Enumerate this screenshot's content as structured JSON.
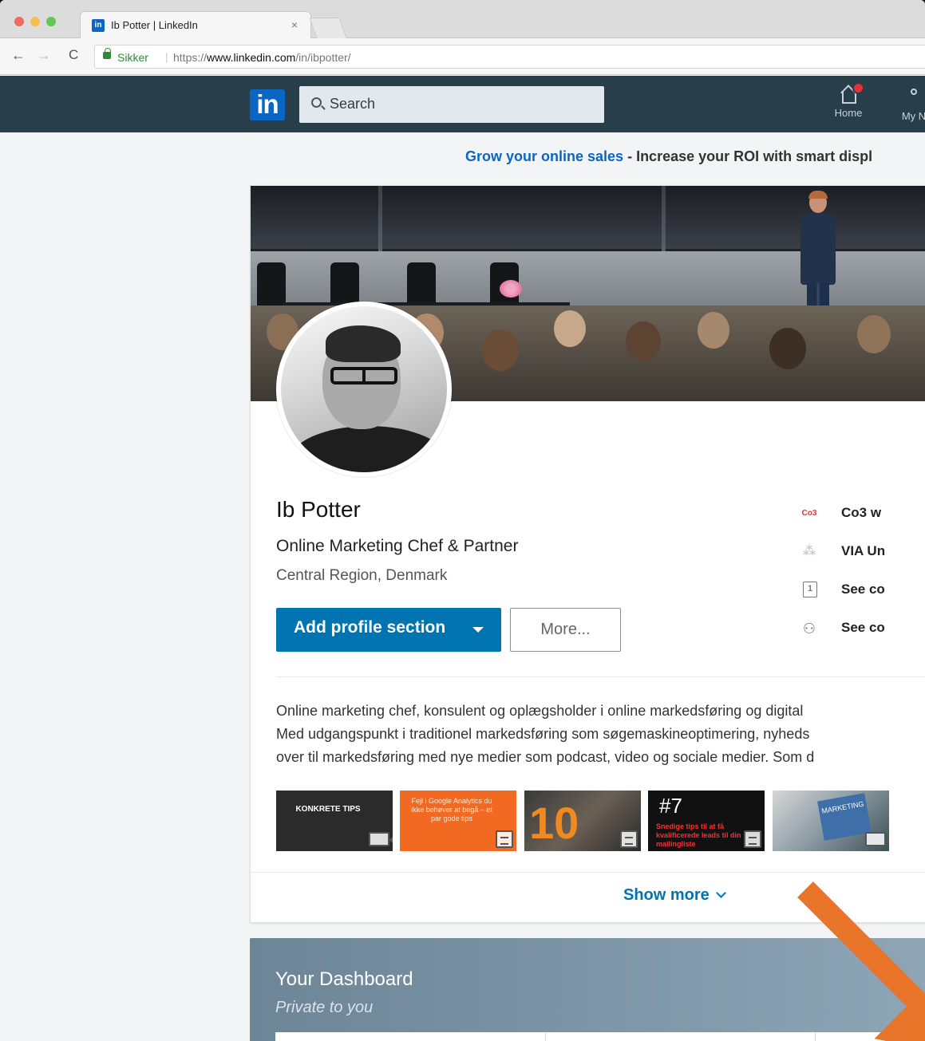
{
  "browser": {
    "tab_title": "Ib Potter | LinkedIn",
    "tab_close": "×",
    "secure_label": "Sikker",
    "url_prefix": "https://",
    "url_domain": "www.linkedin.com",
    "url_path": "/in/ibpotter/",
    "nav_back": "←",
    "nav_forward": "→",
    "nav_reload": "C"
  },
  "linkedin_nav": {
    "logo": "in",
    "search_placeholder": "Search",
    "items": [
      {
        "label": "Home",
        "icon": "home-icon"
      },
      {
        "label": "My N",
        "icon": "network-icon"
      }
    ]
  },
  "ad": {
    "link_text": "Grow your online sales",
    "separator": " - ",
    "text": "Increase your ROI with smart displ"
  },
  "profile": {
    "name": "Ib Potter",
    "headline": "Online Marketing Chef & Partner",
    "location": "Central Region, Denmark",
    "add_section_label": "Add profile section",
    "more_label": "More...",
    "side_links": [
      {
        "icon_text": "Co3",
        "label": "Co3 w"
      },
      {
        "icon_text": "",
        "label": "VIA Un"
      },
      {
        "icon_text": "1",
        "label": "See co"
      },
      {
        "icon_text": "",
        "label": "See co"
      }
    ],
    "summary_lines": [
      "Online marketing chef, konsulent og oplægsholder i online markedsføring og digital",
      "Med udgangspunkt i traditionel markedsføring som søgemaskineoptimering, nyheds",
      "over til markedsføring med nye medier som podcast, video og sociale medier. Som d"
    ],
    "media": [
      {
        "text": "KONKRETE TIPS",
        "type": "video"
      },
      {
        "text": "Fejl i Google Analytics du ikke behøver at begå – et par gode tips",
        "type": "document"
      },
      {
        "text": "10",
        "type": "document"
      },
      {
        "text": "#7",
        "subtext": "Snedige tips til at få kvalificerede leads til din mailingliste",
        "type": "document"
      },
      {
        "text": "MARKETING",
        "type": "video"
      }
    ],
    "show_more_label": "Show more"
  },
  "dashboard": {
    "title": "Your Dashboard",
    "subtitle": "Private to you"
  },
  "colors": {
    "linkedin_blue": "#0073b1",
    "nav_bg": "#283e4a",
    "annotation_arrow": "#e8752a"
  }
}
